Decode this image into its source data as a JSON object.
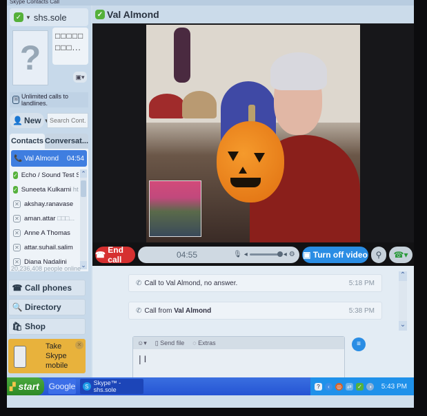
{
  "menubar": {
    "text": "Skype  Contacts  Call"
  },
  "account": {
    "username": "shs.sole",
    "mood_text": "□□□□□ □□□...",
    "promo": "Unlimited calls to landlines."
  },
  "toolbar": {
    "new_label": "New",
    "search_placeholder": "Search Cont..."
  },
  "tabs": [
    {
      "label": "Contacts"
    },
    {
      "label": "Conversat..."
    }
  ],
  "active_call": {
    "name": "Val Almond",
    "duration": "04:54"
  },
  "contacts": [
    {
      "name": "Echo / Sound Test S...",
      "status": "online"
    },
    {
      "name": "Suneeta Kulkarni",
      "note": "ht...",
      "status": "online"
    },
    {
      "name": "akshay.ranavase",
      "status": "offline"
    },
    {
      "name": "aman.attar",
      "note": "□□□...",
      "status": "offline"
    },
    {
      "name": "Anne A Thomas",
      "status": "offline"
    },
    {
      "name": "attar.suhail.salim",
      "status": "offline"
    },
    {
      "name": "Diana Nadalini",
      "status": "offline"
    }
  ],
  "online_count": "20,236,408 people online",
  "nav": [
    {
      "label": "Call phones",
      "icon": "phone-icon"
    },
    {
      "label": "Directory",
      "icon": "magnifier-icon"
    },
    {
      "label": "Shop",
      "icon": "bag-icon"
    }
  ],
  "ad": {
    "line1": "Take",
    "line2": "Skype",
    "line3": "mobile"
  },
  "conversation": {
    "contact": "Val Almond",
    "call_timer": "04:55",
    "end_call_label": "End call",
    "video_label": "Turn off video",
    "messages": [
      {
        "prefix": "Call to Val Almond, no answer.",
        "bold": "",
        "time": "5:18 PM"
      },
      {
        "prefix": "Call from ",
        "bold": "Val Almond",
        "time": "5:38 PM"
      }
    ],
    "input_toolbar": {
      "emoticon": "☺▾",
      "send_file": "Send file",
      "extras": "Extras"
    }
  },
  "taskbar": {
    "start_label": "start",
    "items": [
      {
        "label": "Google"
      },
      {
        "label": "Skype™ - shs.sole"
      }
    ],
    "clock": "5:43 PM"
  },
  "colors": {
    "accent": "#2a8de4",
    "end_call": "#d63030",
    "online": "#56b13c",
    "active_row": "#3f7ee0"
  }
}
